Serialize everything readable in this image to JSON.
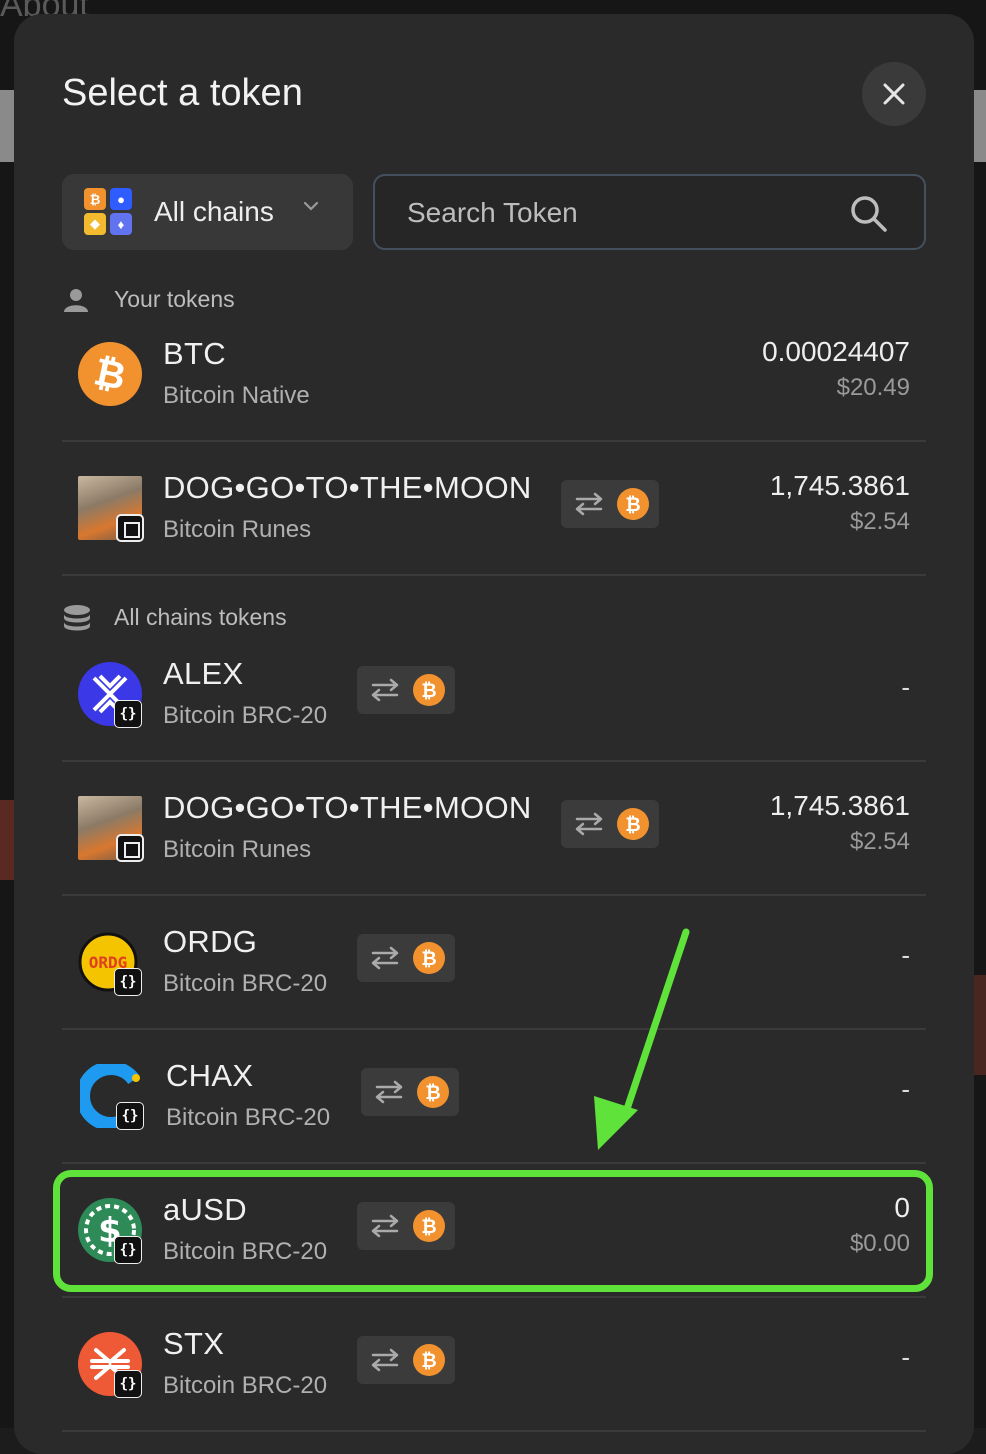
{
  "background": {
    "about_text": "About"
  },
  "header": {
    "title": "Select a token",
    "close_icon": "close-icon"
  },
  "filter": {
    "chains_label": "All chains"
  },
  "search": {
    "placeholder": "Search Token"
  },
  "sections": {
    "your_tokens": "Your tokens",
    "all_chains_tokens": "All chains tokens"
  },
  "your_tokens": [
    {
      "name": "BTC",
      "chain": "Bitcoin Native",
      "amount": "0.00024407",
      "usd": "$20.49",
      "icon": "btc-icon"
    },
    {
      "name": "DOG•GO•TO•THE•MOON",
      "chain": "Bitcoin Runes",
      "amount": "1,745.3861",
      "usd": "$2.54",
      "icon": "dog-icon"
    }
  ],
  "all_tokens": [
    {
      "name": "ALEX",
      "chain": "Bitcoin BRC-20",
      "amount": "-",
      "usd": "",
      "icon": "alex-icon"
    },
    {
      "name": "DOG•GO•TO•THE•MOON",
      "chain": "Bitcoin Runes",
      "amount": "1,745.3861",
      "usd": "$2.54",
      "icon": "dog-icon"
    },
    {
      "name": "ORDG",
      "chain": "Bitcoin BRC-20",
      "amount": "-",
      "usd": "",
      "icon": "ordg-icon"
    },
    {
      "name": "CHAX",
      "chain": "Bitcoin BRC-20",
      "amount": "-",
      "usd": "",
      "icon": "chax-icon"
    },
    {
      "name": "aUSD",
      "chain": "Bitcoin BRC-20",
      "amount": "0",
      "usd": "$0.00",
      "icon": "ausd-icon"
    },
    {
      "name": "STX",
      "chain": "Bitcoin BRC-20",
      "amount": "-",
      "usd": "",
      "icon": "stx-icon"
    }
  ],
  "logo_text": {
    "ordg": "ORDG"
  },
  "colors": {
    "highlight": "#5fe33a",
    "btc": "#f1922f",
    "modal_bg": "#2a2a2a"
  }
}
